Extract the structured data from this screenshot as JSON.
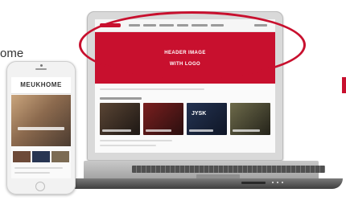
{
  "caption": {
    "partial_text": "ome"
  },
  "laptop_screen": {
    "header_banner": {
      "line1": "HEADER IMAGE",
      "line2": "WITH LOGO"
    },
    "tile_brand": "JYSK"
  },
  "phone_screen": {
    "logo_text": "MEUKHOME"
  },
  "colors": {
    "brand_red": "#c8102e"
  }
}
